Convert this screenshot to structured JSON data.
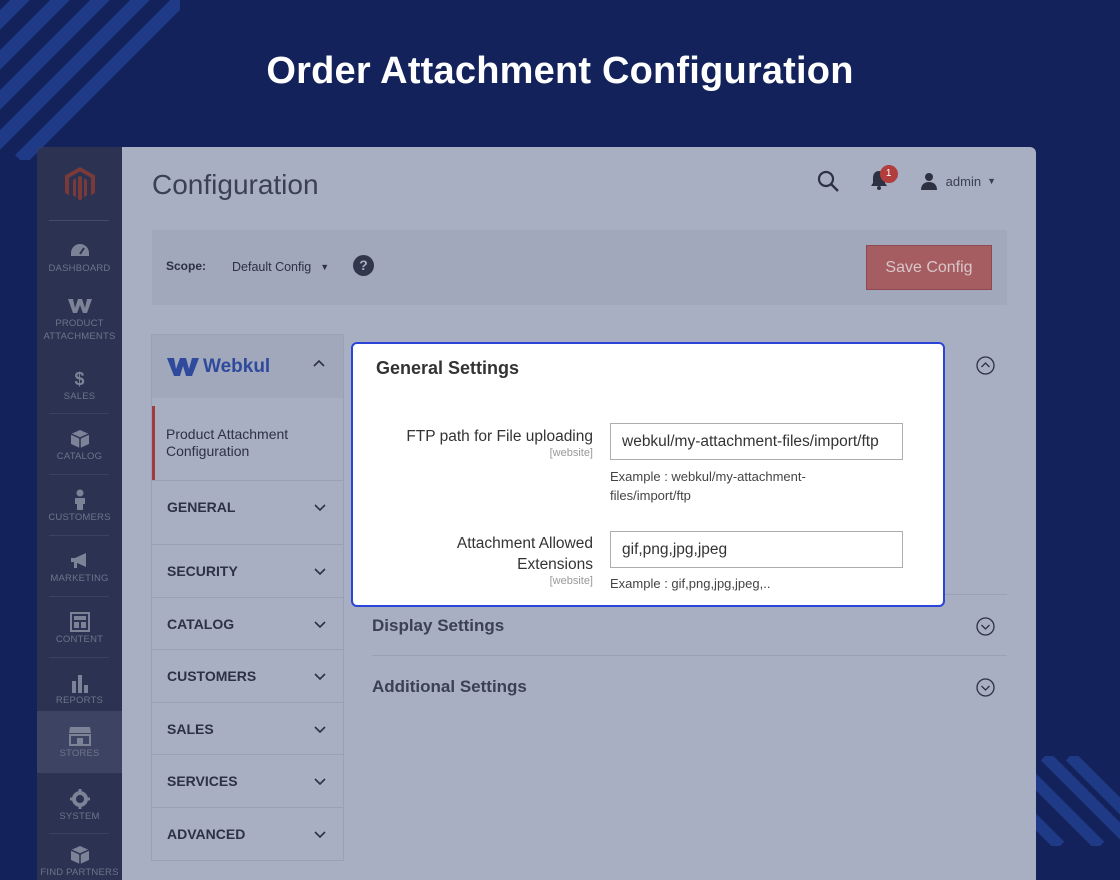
{
  "banner": {
    "title": "Order Attachment Configuration"
  },
  "sidebar": {
    "items": [
      {
        "label": "DASHBOARD",
        "icon": "dashboard-icon"
      },
      {
        "label": "PRODUCT ATTACHMENTS",
        "icon": "webkul-w-icon"
      },
      {
        "label": "SALES",
        "icon": "dollar-icon"
      },
      {
        "label": "CATALOG",
        "icon": "box-icon"
      },
      {
        "label": "CUSTOMERS",
        "icon": "person-icon"
      },
      {
        "label": "MARKETING",
        "icon": "megaphone-icon"
      },
      {
        "label": "CONTENT",
        "icon": "layout-icon"
      },
      {
        "label": "REPORTS",
        "icon": "bar-chart-icon"
      },
      {
        "label": "STORES",
        "icon": "store-icon"
      },
      {
        "label": "SYSTEM",
        "icon": "gear-icon"
      },
      {
        "label": "FIND PARTNERS",
        "icon": "cube-icon"
      }
    ]
  },
  "header": {
    "title": "Configuration",
    "notification_count": "1",
    "user_name": "admin"
  },
  "scope": {
    "label": "Scope:",
    "value": "Default Config",
    "help": "?",
    "save_label": "Save Config"
  },
  "tabs": {
    "vendor": "Webkul",
    "active_item": "Product Attachment Configuration",
    "sections": [
      "GENERAL",
      "SECURITY",
      "CATALOG",
      "CUSTOMERS",
      "SALES",
      "SERVICES",
      "ADVANCED"
    ]
  },
  "sections": {
    "display": "Display Settings",
    "additional": "Additional Settings"
  },
  "general": {
    "title": "General Settings",
    "ftp_label": "FTP path for File uploading",
    "ftp_scope": "[website]",
    "ftp_value": "webkul/my-attachment-files/import/ftp",
    "ftp_note": "Example : webkul/my-attachment-files/import/ftp",
    "ext_label": "Attachment Allowed Extensions",
    "ext_scope": "[website]",
    "ext_value": "gif,png,jpg,jpeg",
    "ext_note": "Example : gif,png,jpg,jpeg,.."
  },
  "colors": {
    "background": "#13225a",
    "save_button": "#a55d62",
    "popup_border": "#2c45d9",
    "accent_red": "#a23c3c"
  }
}
